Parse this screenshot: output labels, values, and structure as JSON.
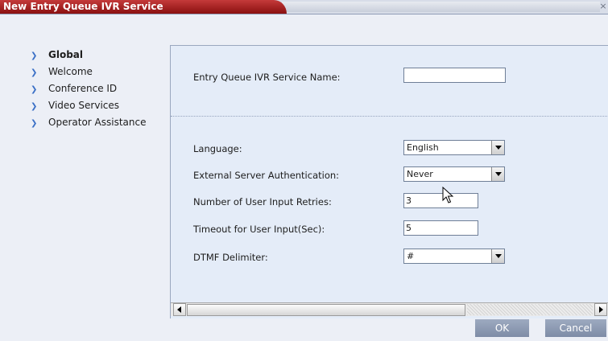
{
  "window": {
    "title": "New Entry Queue IVR Service",
    "close_label": "×"
  },
  "nav": {
    "items": [
      "Global",
      "Welcome",
      "Conference ID",
      "Video Services",
      "Operator Assistance"
    ]
  },
  "form": {
    "service_name": {
      "label": "Entry Queue IVR Service Name:",
      "value": ""
    },
    "language": {
      "label": "Language:",
      "value": "English"
    },
    "ext_auth": {
      "label": "External Server Authentication:",
      "value": "Never"
    },
    "retries": {
      "label": "Number of User Input Retries:",
      "value": "3"
    },
    "timeout": {
      "label": "Timeout for User Input(Sec):",
      "value": "5"
    },
    "dtmf": {
      "label": "DTMF Delimiter:",
      "value": "#"
    }
  },
  "footer": {
    "ok": "OK",
    "cancel": "Cancel"
  },
  "colors": {
    "title_accent": "#a61d1d",
    "nav_arrow": "#3a6fc6",
    "panel_bg": "#e4ecf8",
    "button_bg": "#8a97ae"
  },
  "icons": {
    "nav_bullet": "chevron-right-icon",
    "dropdown": "triangle-down-icon",
    "cursor": "mouse-pointer-icon"
  }
}
